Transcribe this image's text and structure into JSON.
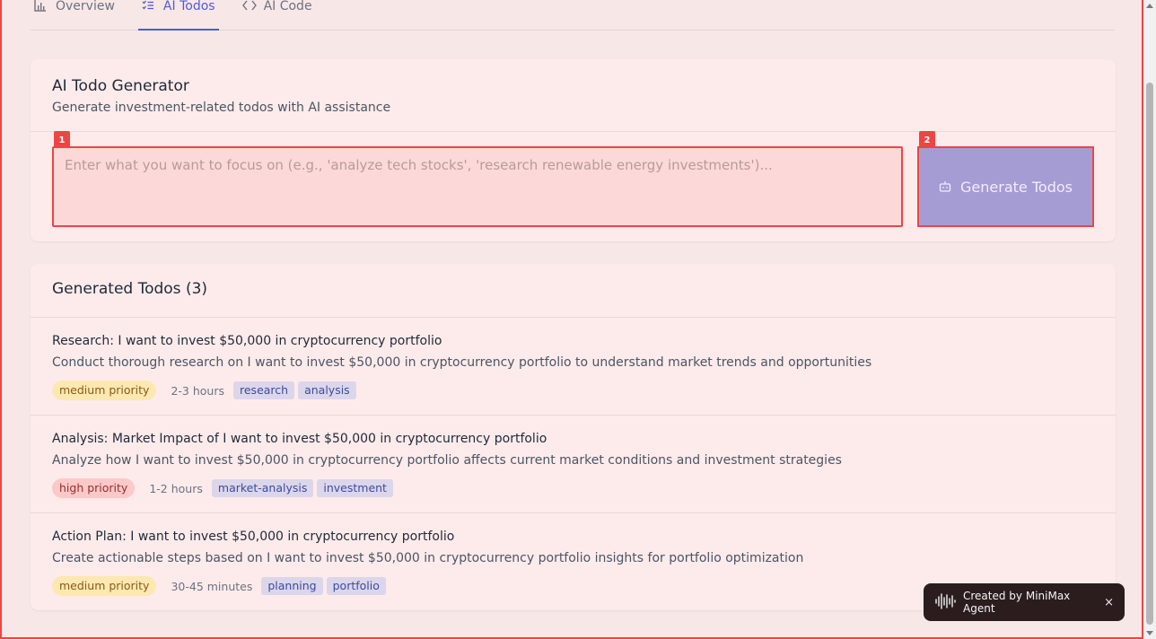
{
  "tabs": [
    {
      "label": "Overview",
      "icon": "bar-chart-icon",
      "active": false
    },
    {
      "label": "AI Todos",
      "icon": "list-checks-icon",
      "active": true
    },
    {
      "label": "AI Code",
      "icon": "code-icon",
      "active": false
    }
  ],
  "generator": {
    "title": "AI Todo Generator",
    "subtitle": "Generate investment-related todos with AI assistance",
    "input_placeholder": "Enter what you want to focus on (e.g., 'analyze tech stocks', 'research renewable energy investments')...",
    "input_value": "",
    "input_marker": "1",
    "button_label": "Generate Todos",
    "button_marker": "2",
    "button_icon": "bot-icon"
  },
  "todos": {
    "title": "Generated Todos (3)",
    "items": [
      {
        "title": "Research: I want to invest $50,000 in cryptocurrency portfolio",
        "description": "Conduct thorough research on I want to invest $50,000 in cryptocurrency portfolio to understand market trends and opportunities",
        "priority": "medium priority",
        "time": "2-3 hours",
        "tags": [
          "research",
          "analysis"
        ]
      },
      {
        "title": "Analysis: Market Impact of I want to invest $50,000 in cryptocurrency portfolio",
        "description": "Analyze how I want to invest $50,000 in cryptocurrency portfolio affects current market conditions and investment strategies",
        "priority": "high priority",
        "time": "1-2 hours",
        "tags": [
          "market-analysis",
          "investment"
        ]
      },
      {
        "title": "Action Plan: I want to invest $50,000 in cryptocurrency portfolio",
        "description": "Create actionable steps based on I want to invest $50,000 in cryptocurrency portfolio insights for portfolio optimization",
        "priority": "medium priority",
        "time": "30-45 minutes",
        "tags": [
          "planning",
          "portfolio"
        ]
      }
    ]
  },
  "toast": {
    "text": "Created by MiniMax Agent",
    "close_label": "×",
    "icon": "waveform-icon"
  },
  "colors": {
    "accent": "#4f5bd5",
    "highlight_border": "#ef4444",
    "button_bg": "#a69cd4",
    "medium_priority_bg": "#fde8b2",
    "high_priority_bg": "#fcc9c9",
    "tag_bg": "#dcd6ea"
  }
}
